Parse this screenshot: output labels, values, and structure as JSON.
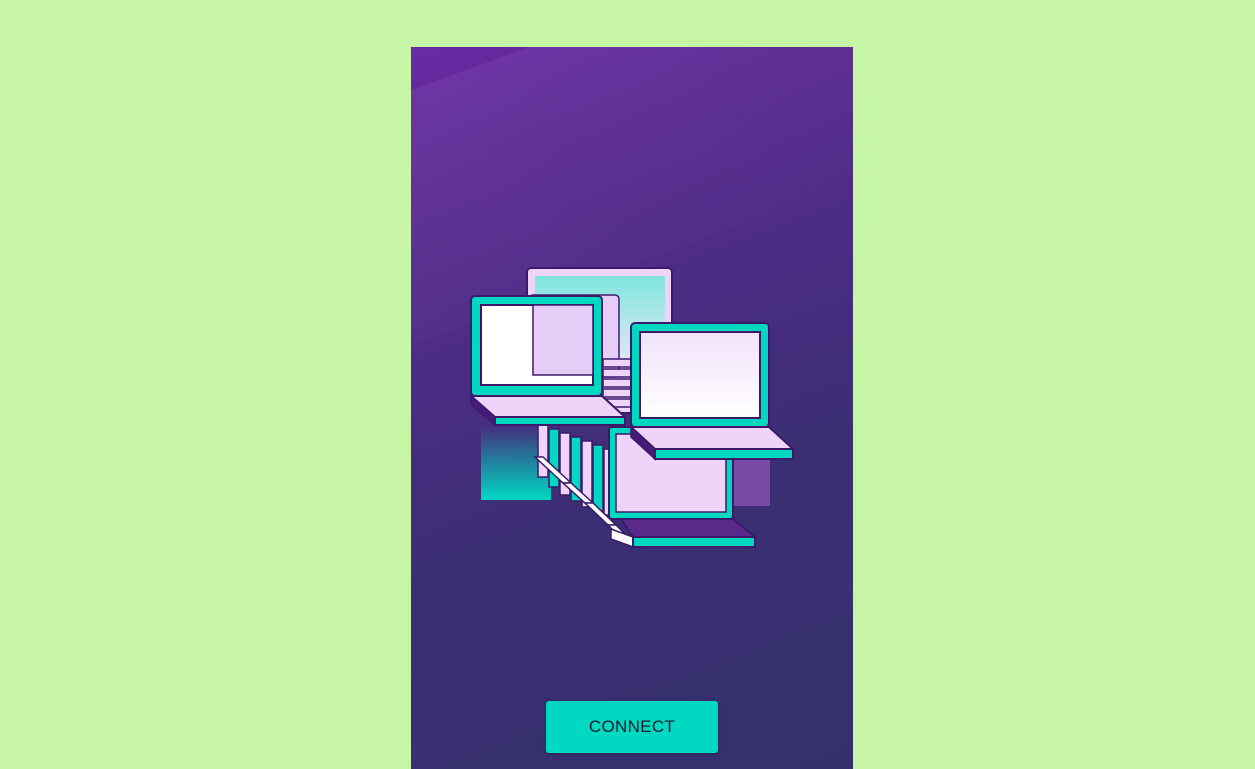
{
  "screen": {
    "background_color": "#c5f5a5",
    "panel_gradient": [
      "#6a2aa4",
      "#35306d"
    ]
  },
  "illustration": {
    "icon": "laptops-network-illustration"
  },
  "actions": {
    "connect_label": "CONNECT",
    "connect_color": "#00d8c2"
  }
}
